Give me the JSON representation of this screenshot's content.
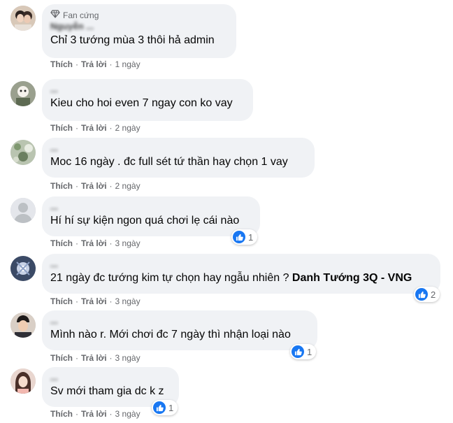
{
  "actions": {
    "like": "Thích",
    "reply": "Trả lời",
    "sep": "·"
  },
  "colors": {
    "bubble": "#f0f2f5",
    "like_blue": "#1877f2",
    "meta": "#65676b"
  },
  "comments": [
    {
      "badge": "Fan cứng",
      "name": "Nguyễn ...",
      "text": "Chỉ 3 tướng mùa 3 thôi hả admin",
      "time": "1 ngày"
    },
    {
      "name": "...",
      "text": "Kieu cho hoi even 7 ngay con ko vay",
      "time": "2 ngày"
    },
    {
      "name": "...",
      "text": "Moc 16 ngày . đc full sét tứ thần hay chọn 1 vay",
      "time": "2 ngày"
    },
    {
      "name": "...",
      "text": "Hí hí sự kiện ngon quá chơi lẹ cái nào",
      "time": "3 ngày",
      "reactions": "1"
    },
    {
      "name": "...",
      "text": "21 ngày đc tướng kim tự chọn hay ngẫu nhiên ?",
      "tag": "Danh Tướng 3Q - VNG",
      "time": "3 ngày",
      "reactions": "2"
    },
    {
      "name": "...",
      "text": "Mình nào r. Mới chơi đc 7 ngày thì nhận loại nào",
      "time": "3 ngày",
      "reactions": "1"
    },
    {
      "name": "...",
      "text": "Sv mới tham gia dc k z",
      "time": "3 ngày",
      "reactions": "1"
    }
  ]
}
